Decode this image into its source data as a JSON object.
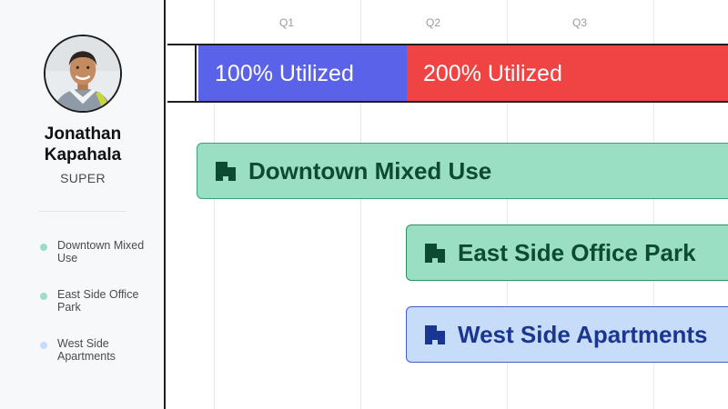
{
  "person": {
    "name_line1": "Jonathan",
    "name_line2": "Kapahala",
    "role": "SUPER"
  },
  "legend": [
    {
      "label": "Downtown Mixed Use",
      "color": "#9adfc3"
    },
    {
      "label": "East Side Office Park",
      "color": "#9adfc3"
    },
    {
      "label": "West Side Apartments",
      "color": "#c6dcf8"
    }
  ],
  "timeline": {
    "quarters": [
      "Q1",
      "Q2",
      "Q3"
    ]
  },
  "utilization": [
    {
      "label": "100% Utilized",
      "color": "#5b62ea"
    },
    {
      "label": "200% Utilized",
      "color": "#ef4344"
    }
  ],
  "projects": [
    {
      "label": "Downtown Mixed Use",
      "fill": "#9adfc3",
      "border": "#3aa57a",
      "text_color": "#0d4a33",
      "icon": "building-icon"
    },
    {
      "label": "East Side Office Park",
      "fill": "#9adfc3",
      "border": "#2d8d63",
      "text_color": "#0d4a33",
      "icon": "building-icon"
    },
    {
      "label": "West Side Apartments",
      "fill": "#c6dcf8",
      "border": "#3f60c9",
      "text_color": "#1b3691",
      "icon": "building-icon"
    }
  ]
}
